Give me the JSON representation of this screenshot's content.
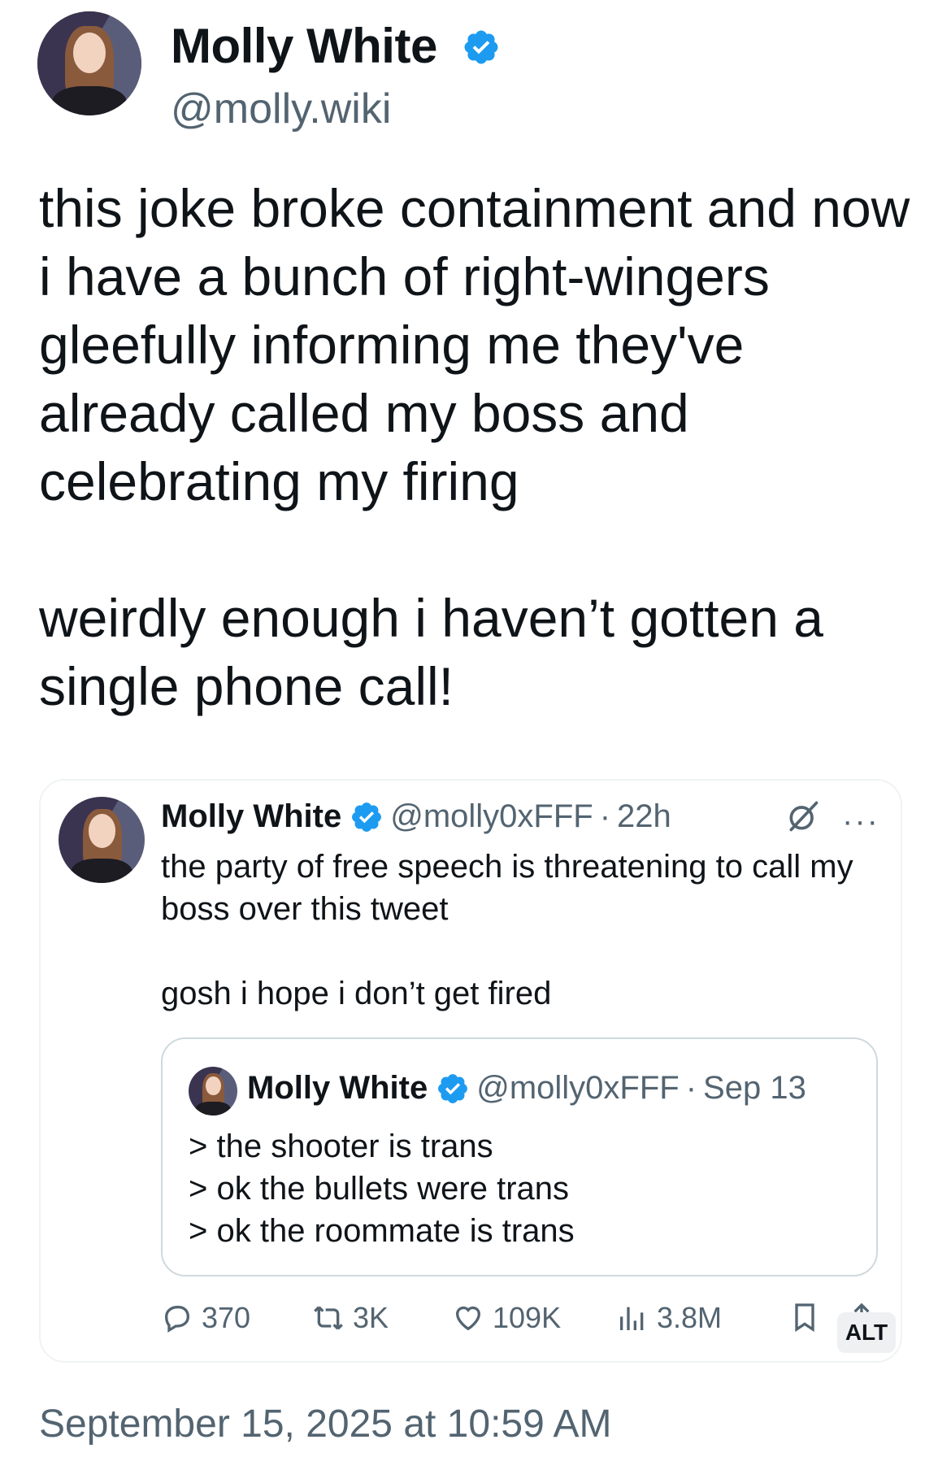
{
  "post": {
    "author_name": "Molly White",
    "author_handle": "@molly.wiki",
    "body_para1": "this joke broke containment and now i have a bunch of right-wingers gleefully informing me they've already called my boss and celebrating my firing",
    "body_para2": "weirdly enough i haven’t gotten a single phone call!",
    "timestamp": "September 15, 2025 at 10:59 AM"
  },
  "quoted": {
    "author_name": "Molly White",
    "author_handle": "@molly0xFFF",
    "separator": "·",
    "time": "22h",
    "text_para1": "the party of free speech is threatening to call my boss over this tweet",
    "text_para2": "gosh i hope i don’t get fired",
    "more_label": "···",
    "stats": {
      "replies": "370",
      "reposts": "3K",
      "likes": "109K",
      "views": "3.8M"
    },
    "alt_label": "ALT"
  },
  "nested_quote": {
    "author_name": "Molly White",
    "author_handle": "@molly0xFFF",
    "separator": "·",
    "time": "Sep 13",
    "text": "> the shooter is trans\n> ok the bullets were trans\n> ok the roommate is trans"
  },
  "colors": {
    "verified": "#1d9bf0",
    "muted": "#536471",
    "text": "#0f1419"
  },
  "icons": [
    "verified-badge-icon",
    "grok-icon",
    "more-icon",
    "reply-icon",
    "repost-icon",
    "like-icon",
    "views-icon",
    "bookmark-icon",
    "share-icon"
  ]
}
